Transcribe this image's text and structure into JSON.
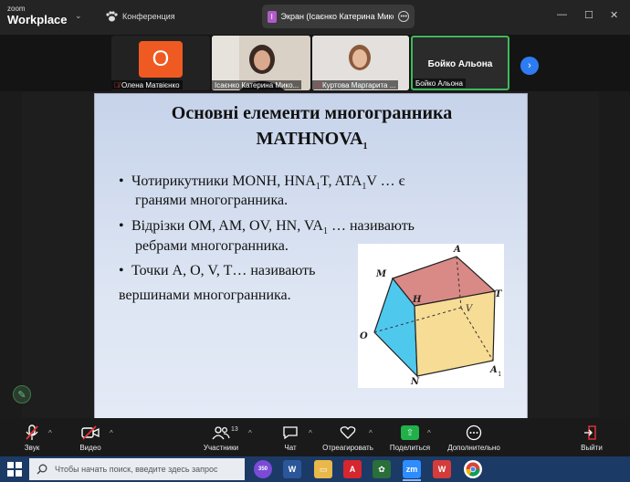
{
  "app": {
    "brand_small": "zoom",
    "brand_name": "Workplace",
    "conference_label": "Конференция",
    "screen_tab_badge": "I",
    "screen_tab_title": "Экран (Ісаєнко Катерина Микол"
  },
  "participants": [
    {
      "name": "Олена Матвієнко",
      "avatar_letter": "O",
      "muted": true
    },
    {
      "name": "Ісаєнко Катерина Мико...",
      "muted": false
    },
    {
      "name": "Куртова Маргарита ...",
      "muted": true
    },
    {
      "name": "Бойко Альона",
      "center_label": "Бойко Альона",
      "muted": false
    }
  ],
  "slide": {
    "title_line1": "Основні елементи многогранника",
    "title_line2": "MATHNOVA",
    "title_sub": "1",
    "bullets": [
      {
        "a": "Чотирикутники MONH, HNA",
        "s1": "1",
        "b": "T, ATA",
        "s2": "1",
        "c": "V … є",
        "line2": "гранями многогранника."
      },
      {
        "a": "Відрізки OM, AM, OV, HN, VA",
        "s1": "1",
        "b": " … називають",
        "line2": "ребрами многогранника."
      },
      {
        "a": "Точки A, O, V, T… називають",
        "line2": "вершинами многогранника."
      }
    ],
    "figure_labels": {
      "A": "A",
      "M": "M",
      "H": "H",
      "T": "T",
      "V": "V",
      "O": "O",
      "N": "N",
      "A1": "A",
      "A1_sub": "1"
    }
  },
  "toolbar": {
    "sound": "Звук",
    "video": "Видео",
    "participants": "Участники",
    "participants_count": "13",
    "chat": "Чат",
    "react": "Отреагировать",
    "share": "Поделиться",
    "more": "Дополнительно",
    "leave": "Выйти"
  },
  "taskbar": {
    "search_placeholder": "Чтобы начать поиск, введите здесь запрос",
    "viber_badge": "350",
    "zoom_label": "zm"
  },
  "colors": {
    "accent_blue": "#2d7cf3",
    "active_green": "#3fb95c",
    "share_green": "#21b14a",
    "avatar_orange": "#ef5a23"
  }
}
